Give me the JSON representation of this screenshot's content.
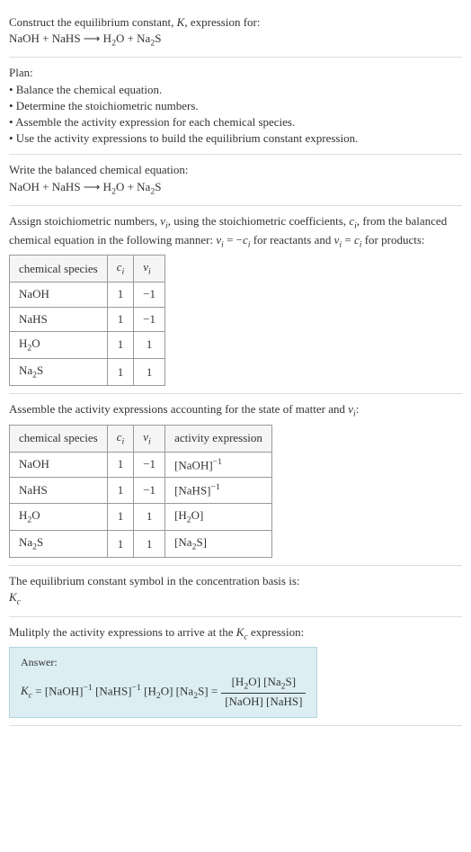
{
  "intro": {
    "line1": "Construct the equilibrium constant, K, expression for:",
    "equation": "NaOH + NaHS ⟶ H₂O + Na₂S"
  },
  "plan": {
    "title": "Plan:",
    "items": [
      "• Balance the chemical equation.",
      "• Determine the stoichiometric numbers.",
      "• Assemble the activity expression for each chemical species.",
      "• Use the activity expressions to build the equilibrium constant expression."
    ]
  },
  "balanced": {
    "title": "Write the balanced chemical equation:",
    "equation": "NaOH + NaHS ⟶ H₂O + Na₂S"
  },
  "stoich": {
    "intro": "Assign stoichiometric numbers, νᵢ, using the stoichiometric coefficients, cᵢ, from the balanced chemical equation in the following manner: νᵢ = −cᵢ for reactants and νᵢ = cᵢ for products:",
    "headers": [
      "chemical species",
      "cᵢ",
      "νᵢ"
    ],
    "rows": [
      {
        "species": "NaOH",
        "c": "1",
        "v": "−1"
      },
      {
        "species": "NaHS",
        "c": "1",
        "v": "−1"
      },
      {
        "species": "H₂O",
        "c": "1",
        "v": "1"
      },
      {
        "species": "Na₂S",
        "c": "1",
        "v": "1"
      }
    ]
  },
  "activity": {
    "intro": "Assemble the activity expressions accounting for the state of matter and νᵢ:",
    "headers": [
      "chemical species",
      "cᵢ",
      "νᵢ",
      "activity expression"
    ],
    "rows": [
      {
        "species": "NaOH",
        "c": "1",
        "v": "−1",
        "expr": "[NaOH]⁻¹"
      },
      {
        "species": "NaHS",
        "c": "1",
        "v": "−1",
        "expr": "[NaHS]⁻¹"
      },
      {
        "species": "H₂O",
        "c": "1",
        "v": "1",
        "expr": "[H₂O]"
      },
      {
        "species": "Na₂S",
        "c": "1",
        "v": "1",
        "expr": "[Na₂S]"
      }
    ]
  },
  "symbol": {
    "line1": "The equilibrium constant symbol in the concentration basis is:",
    "line2": "K_c"
  },
  "multiply": {
    "title": "Mulitply the activity expressions to arrive at the K_c expression:"
  },
  "answer": {
    "label": "Answer:",
    "lhs": "K_c = [NaOH]⁻¹ [NaHS]⁻¹ [H₂O] [Na₂S] =",
    "num": "[H₂O] [Na₂S]",
    "den": "[NaOH] [NaHS]"
  }
}
